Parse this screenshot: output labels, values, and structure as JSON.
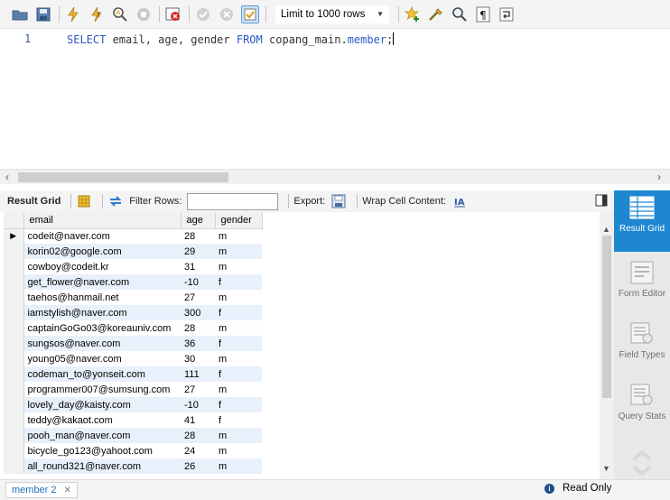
{
  "toolbar": {
    "limit_label": "Limit to 1000 rows",
    "icons": [
      "open-folder-icon",
      "save-icon",
      "execute-icon",
      "execute-current-icon",
      "explain-icon",
      "stop-icon",
      "toggle-error-icon",
      "commit-icon",
      "rollback-icon",
      "autocommit-icon",
      "bookmark-star-icon",
      "beautify-icon",
      "find-icon",
      "invisible-chars-icon",
      "wrap-icon"
    ]
  },
  "editor": {
    "line_number": "1",
    "code": {
      "kw1": "SELECT",
      "cols": " email, age, gender ",
      "kw2": "FROM",
      "schema": " copang_main.",
      "table": "member",
      "end": ";"
    }
  },
  "result_toolbar": {
    "result_grid": "Result Grid",
    "filter_rows": "Filter Rows:",
    "filter_value": "",
    "export": "Export:",
    "wrap_cell": "Wrap Cell Content:"
  },
  "grid": {
    "columns": [
      "email",
      "age",
      "gender"
    ],
    "rows": [
      [
        "codeit@naver.com",
        "28",
        "m"
      ],
      [
        "korin02@google.com",
        "29",
        "m"
      ],
      [
        "cowboy@codeit.kr",
        "31",
        "m"
      ],
      [
        "get_flower@naver.com",
        "-10",
        "f"
      ],
      [
        "taehos@hanmail.net",
        "27",
        "m"
      ],
      [
        "iamstylish@naver.com",
        "300",
        "f"
      ],
      [
        "captainGoGo03@koreauniv.com",
        "28",
        "m"
      ],
      [
        "sungsos@naver.com",
        "36",
        "f"
      ],
      [
        "young05@naver.com",
        "30",
        "m"
      ],
      [
        "codeman_to@yonseit.com",
        "111",
        "f"
      ],
      [
        "programmer007@sumsung.com",
        "27",
        "m"
      ],
      [
        "lovely_day@kaisty.com",
        "-10",
        "f"
      ],
      [
        "teddy@kakaot.com",
        "41",
        "f"
      ],
      [
        "pooh_man@naver.com",
        "28",
        "m"
      ],
      [
        "bicycle_go123@yahoot.com",
        "24",
        "m"
      ],
      [
        "all_round321@naver.com",
        "26",
        "m"
      ]
    ]
  },
  "side_panel": {
    "result_grid": "Result Grid",
    "form_editor": "Form Editor",
    "field_types": "Field Types",
    "query_stats": "Query Stats"
  },
  "status": {
    "tab_label": "member 2",
    "tab_close": "✕",
    "readonly": "Read Only"
  },
  "colors": {
    "accent": "#1e87d2",
    "keyword": "#2a58c7",
    "row_alt": "#e8f1fb"
  }
}
